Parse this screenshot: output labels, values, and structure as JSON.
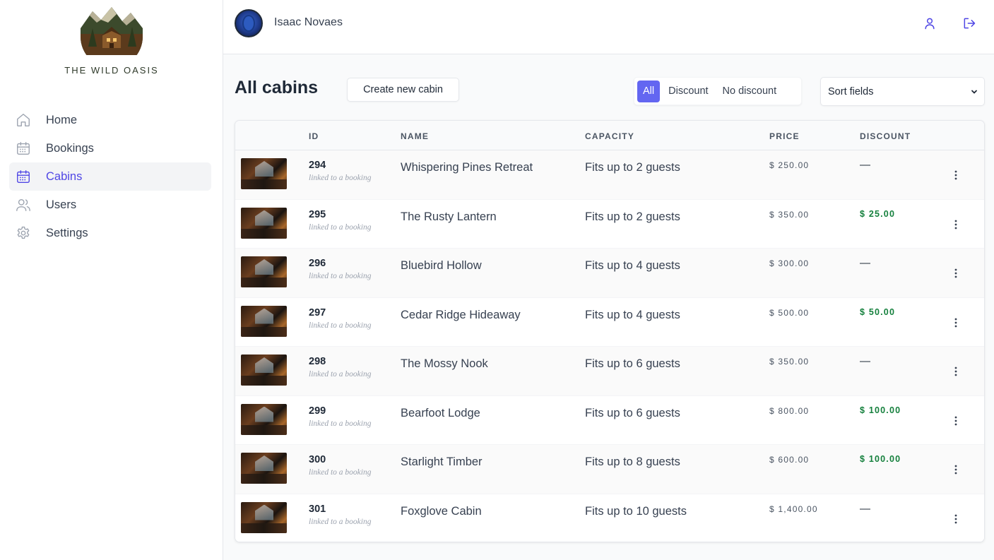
{
  "brand": {
    "name": "THE WILD OASIS"
  },
  "sidebar": {
    "items": [
      {
        "label": "Home",
        "icon": "home-icon"
      },
      {
        "label": "Bookings",
        "icon": "calendar-icon"
      },
      {
        "label": "Cabins",
        "icon": "calendar-icon",
        "active": true
      },
      {
        "label": "Users",
        "icon": "users-icon"
      },
      {
        "label": "Settings",
        "icon": "gear-icon"
      }
    ]
  },
  "header": {
    "user_name": "Isaac Novaes"
  },
  "page": {
    "title": "All cabins",
    "create_button": "Create new cabin",
    "filters": [
      "All",
      "Discount",
      "No discount"
    ],
    "sort": "Sort fields"
  },
  "table": {
    "headers": [
      "ID",
      "NAME",
      "CAPACITY",
      "PRICE",
      "DISCOUNT"
    ],
    "rows": [
      {
        "id": "294",
        "note": "linked to a booking",
        "name": "Whispering Pines Retreat",
        "capacity": "Fits up to 2 guests",
        "price": "$ 250.00",
        "discount": "—"
      },
      {
        "id": "295",
        "note": "linked to a booking",
        "name": "The Rusty Lantern",
        "capacity": "Fits up to 2 guests",
        "price": "$ 350.00",
        "discount": "$ 25.00"
      },
      {
        "id": "296",
        "note": "linked to a booking",
        "name": "Bluebird Hollow",
        "capacity": "Fits up to 4 guests",
        "price": "$ 300.00",
        "discount": "—"
      },
      {
        "id": "297",
        "note": "linked to a booking",
        "name": "Cedar Ridge Hideaway",
        "capacity": "Fits up to 4 guests",
        "price": "$ 500.00",
        "discount": "$ 50.00"
      },
      {
        "id": "298",
        "note": "linked to a booking",
        "name": "The Mossy Nook",
        "capacity": "Fits up to 6 guests",
        "price": "$ 350.00",
        "discount": "—"
      },
      {
        "id": "299",
        "note": "linked to a booking",
        "name": "Bearfoot Lodge",
        "capacity": "Fits up to 6 guests",
        "price": "$ 800.00",
        "discount": "$ 100.00"
      },
      {
        "id": "300",
        "note": "linked to a booking",
        "name": "Starlight Timber",
        "capacity": "Fits up to 8 guests",
        "price": "$ 600.00",
        "discount": "$ 100.00"
      },
      {
        "id": "301",
        "note": "linked to a booking",
        "name": "Foxglove Cabin",
        "capacity": "Fits up to 10 guests",
        "price": "$ 1,400.00",
        "discount": "—"
      }
    ]
  },
  "colors": {
    "accent": "#4f46e5",
    "discount": "#15803d"
  }
}
